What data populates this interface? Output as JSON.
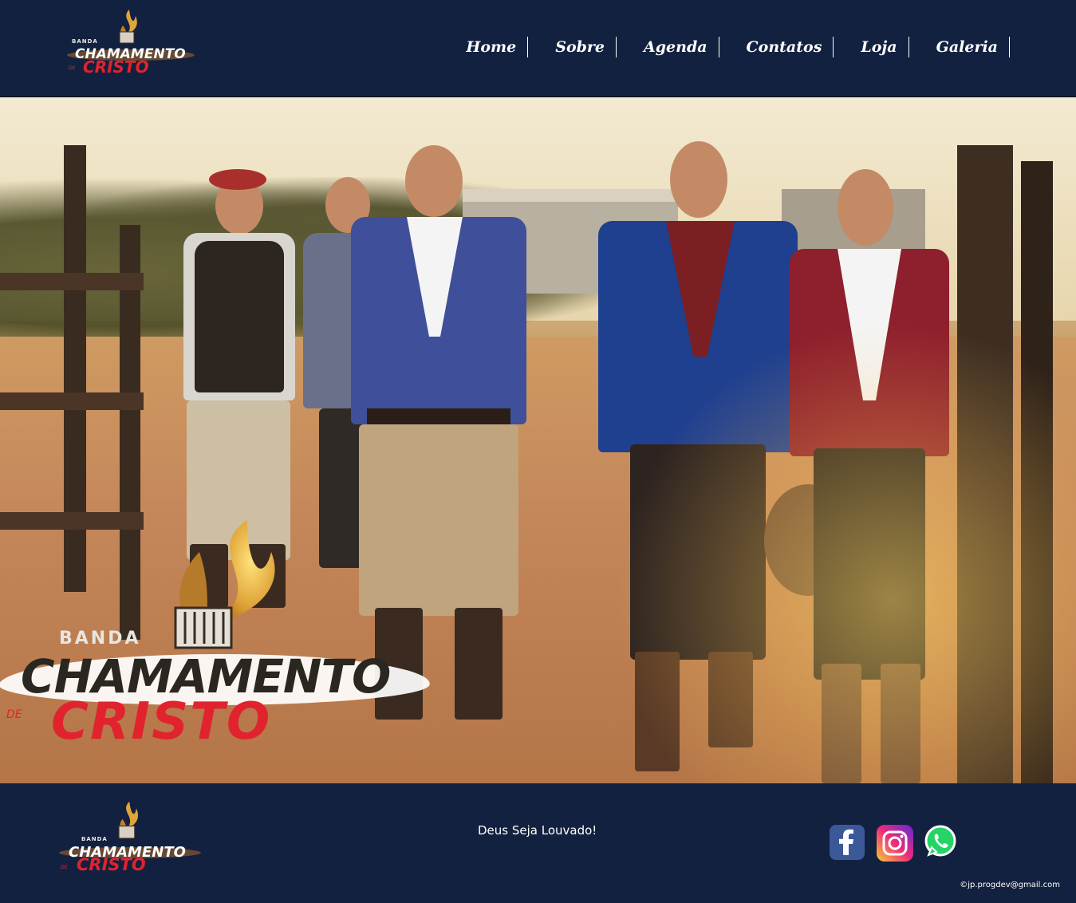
{
  "header": {
    "logo": {
      "banda": "BANDA",
      "word1": "CHAMAMENTO",
      "de": "DE",
      "word2": "CRISTO"
    },
    "nav": [
      {
        "label": "Home"
      },
      {
        "label": "Sobre"
      },
      {
        "label": "Agenda"
      },
      {
        "label": "Contatos"
      },
      {
        "label": "Loja"
      },
      {
        "label": "Galeria"
      }
    ]
  },
  "hero": {
    "logo": {
      "banda": "BANDA",
      "word1": "CHAMAMENTO",
      "de": "DE",
      "word2": "CRISTO"
    }
  },
  "footer": {
    "logo": {
      "banda": "BANDA",
      "word1": "CHAMAMENTO",
      "de": "DE",
      "word2": "CRISTO"
    },
    "tagline": "Deus Seja Louvado!",
    "social": [
      {
        "name": "facebook-icon",
        "color": "#3b5998"
      },
      {
        "name": "instagram-icon",
        "color": "#e1306c"
      },
      {
        "name": "whatsapp-icon",
        "color": "#25d366"
      }
    ],
    "credit": "©jp.progdev@gmail.com"
  },
  "colors": {
    "background": "#132140",
    "accent_red": "#e1232e",
    "flame_gold": "#e0a53a"
  }
}
